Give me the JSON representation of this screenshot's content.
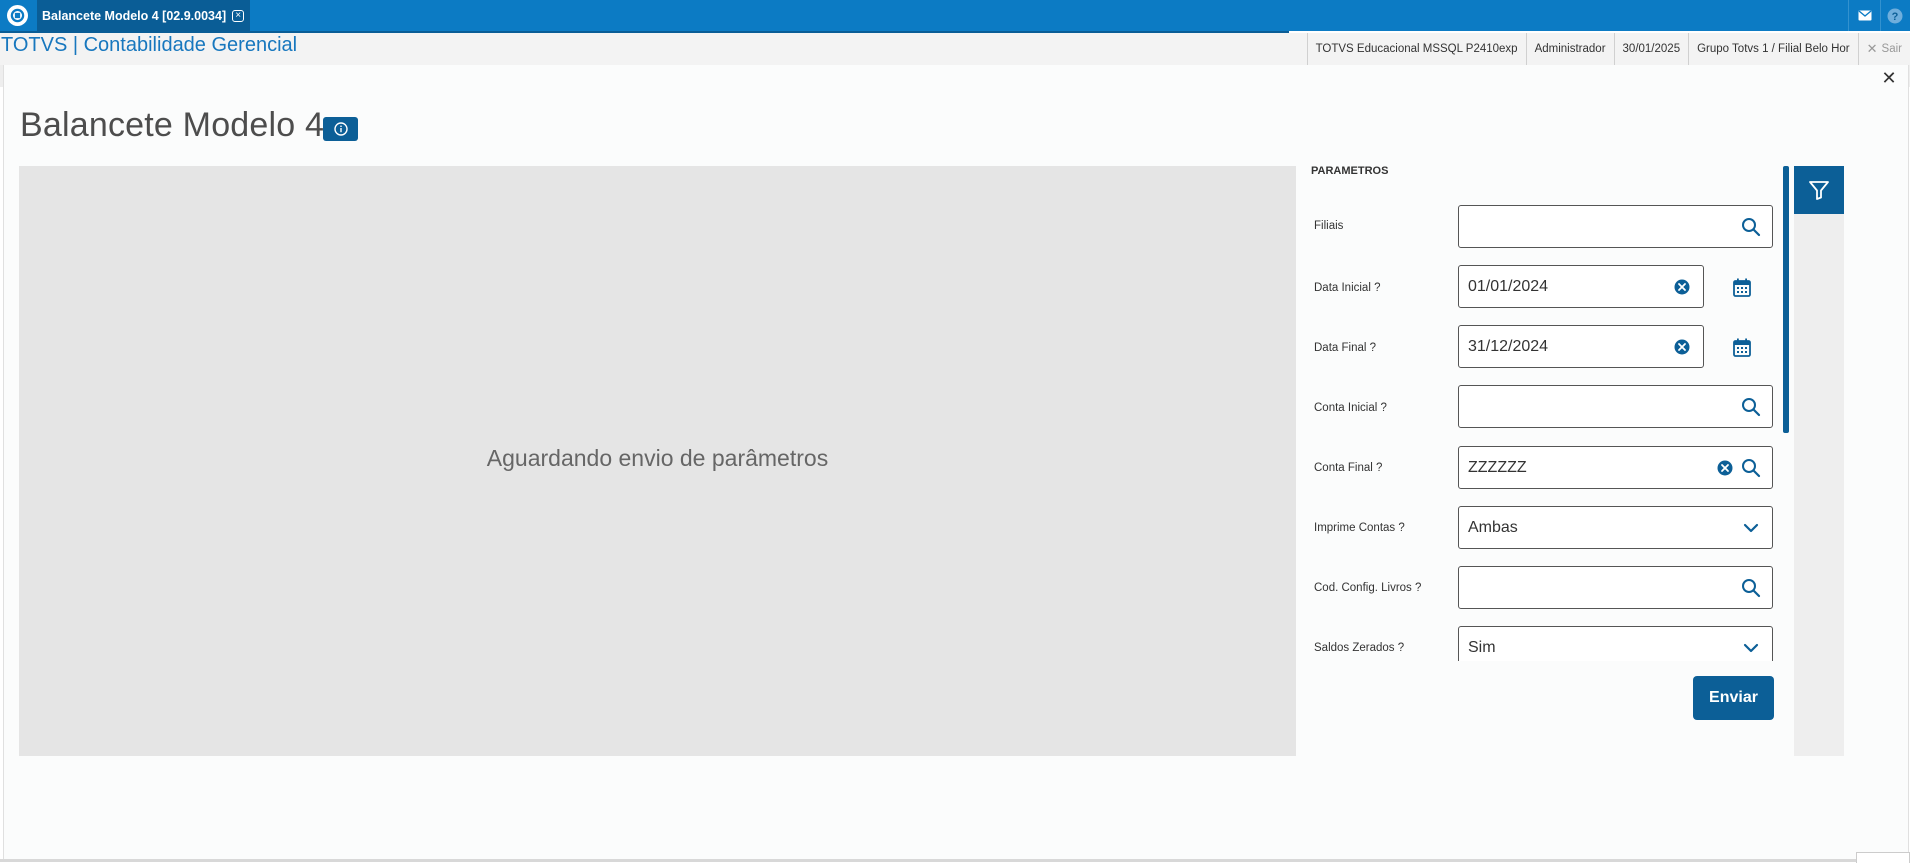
{
  "topbar": {
    "tab_label": "Balancete Modelo 4 [02.9.0034]",
    "logo_icon": "totvs-logo-icon",
    "mail_icon": "mail-icon",
    "help_icon": "help-icon"
  },
  "header": {
    "app_title": "TOTVS | Contabilidade Gerencial",
    "environment": "TOTVS Educacional MSSQL P2410exp",
    "user": "Administrador",
    "date": "30/01/2025",
    "branch": "Grupo Totvs 1 / Filial Belo Hor",
    "exit_label": "Sair"
  },
  "page": {
    "title": "Balancete Modelo 4",
    "preview_message": "Aguardando envio de parâmetros"
  },
  "params": {
    "section_title": "PARAMETROS",
    "submit_label": "Enviar",
    "fields": [
      {
        "label": "Filiais",
        "value": "",
        "type": "lookup"
      },
      {
        "label": "Data Inicial ?",
        "value": "01/01/2024",
        "type": "date"
      },
      {
        "label": "Data Final ?",
        "value": "31/12/2024",
        "type": "date"
      },
      {
        "label": "Conta Inicial ?",
        "value": "",
        "type": "lookup"
      },
      {
        "label": "Conta Final ?",
        "value": "ZZZZZZ",
        "type": "lookup-clear"
      },
      {
        "label": "Imprime Contas ?",
        "value": "Ambas",
        "type": "select"
      },
      {
        "label": "Cod. Config. Livros ?",
        "value": "",
        "type": "lookup"
      },
      {
        "label": "Saldos Zerados ?",
        "value": "Sim",
        "type": "select"
      }
    ]
  },
  "colors": {
    "topbar": "#0c7bc4",
    "primary": "#0c5f97",
    "preview_bg": "#e5e5e5"
  }
}
